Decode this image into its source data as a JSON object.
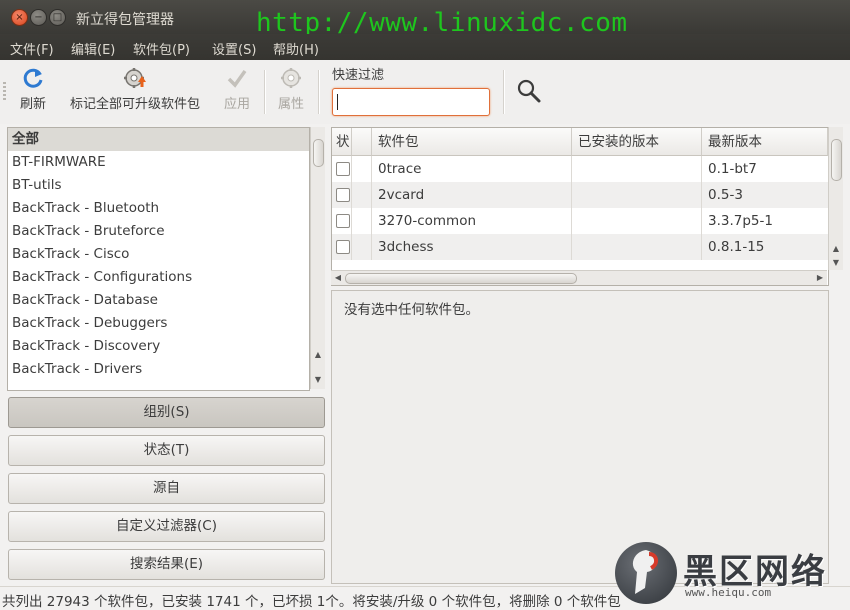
{
  "window": {
    "title": "新立得包管理器",
    "close_glyph": "×",
    "minimize_glyph": "−",
    "maximize_glyph": "□"
  },
  "watermark": "http://www.linuxidc.com",
  "menu": [
    "文件(F)",
    "编辑(E)",
    "软件包(P)",
    "设置(S)",
    "帮助(H)"
  ],
  "toolbar": {
    "reload": "刷新",
    "mark_all_upgrades": "标记全部可升级软件包",
    "apply": "应用",
    "properties": "属性",
    "filter_label": "快速过滤",
    "filter_value": ""
  },
  "categories": [
    "全部",
    "BT-FIRMWARE",
    "BT-utils",
    "BackTrack - Bluetooth",
    "BackTrack - Bruteforce",
    "BackTrack - Cisco",
    "BackTrack - Configurations",
    "BackTrack - Database",
    "BackTrack - Debuggers",
    "BackTrack - Discovery",
    "BackTrack - Drivers"
  ],
  "selected_category": "全部",
  "view_buttons": [
    "组别(S)",
    "状态(T)",
    "源自",
    "自定义过滤器(C)",
    "搜索结果(E)"
  ],
  "active_view": "组别(S)",
  "table": {
    "columns": [
      "状",
      "",
      "软件包",
      "已安装的版本",
      "最新版本"
    ],
    "rows": [
      {
        "name": "0trace",
        "installed": "",
        "latest": "0.1-bt7",
        "checked": false
      },
      {
        "name": "2vcard",
        "installed": "",
        "latest": "0.5-3",
        "checked": false
      },
      {
        "name": "3270-common",
        "installed": "",
        "latest": "3.3.7p5-1",
        "checked": false
      },
      {
        "name": "3dchess",
        "installed": "",
        "latest": "0.8.1-15",
        "checked": false
      }
    ]
  },
  "details_text": "没有选中任何软件包。",
  "status_text": "共列出 27943 个软件包，已安装 1741 个，已坏损 1个。将安装/升级 0 个软件包，将删除 0 个软件包",
  "logo": {
    "text": "黑区网络",
    "sub": "www.heiqu.com"
  },
  "colors": {
    "accent": "#e0703a",
    "titlebar": "#3c3b37",
    "watermark": "#1ec61e"
  }
}
